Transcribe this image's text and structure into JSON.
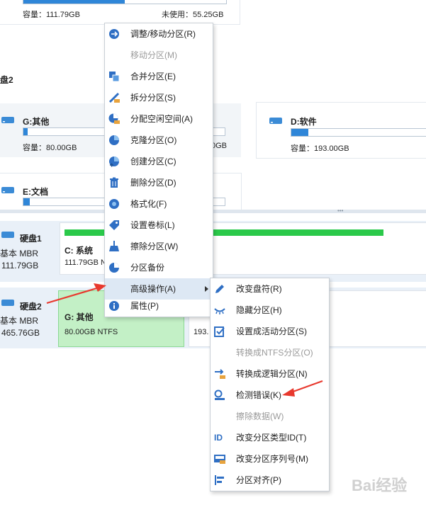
{
  "top_card": {
    "capacity": "容量：111.79GB",
    "unused": "未使用：55.25GB",
    "used_fraction": 0.5
  },
  "section_title": "盘2",
  "cards": {
    "g": {
      "name": "G:其他",
      "capacity": "容量：80.00GB",
      "used_fraction": 0.02,
      "partial_right": "0GB"
    },
    "d": {
      "name": "D:软件",
      "capacity": "容量：193.00GB",
      "used_fraction": 0.12
    },
    "e": {
      "name": "E:文档",
      "used_fraction": 0.03
    }
  },
  "divider_dots": "•••",
  "disks": [
    {
      "name": "硬盘1",
      "type": "基本 MBR",
      "size": "111.79GB",
      "partition_label": "C: 系统",
      "partition_size": "111.79GB NTFS",
      "used_fraction": 0.52
    },
    {
      "name": "硬盘2",
      "type": "基本 MBR",
      "size": "465.76GB",
      "partition_label": "G: 其他",
      "partition_size": "80.00GB NTFS",
      "next_size": "193."
    }
  ],
  "context_menu": [
    {
      "label": "调整/移动分区(R)",
      "icon": "resize-icon",
      "enabled": true
    },
    {
      "label": "移动分区(M)",
      "icon": "",
      "enabled": false
    },
    {
      "label": "合并分区(E)",
      "icon": "merge-icon",
      "enabled": true
    },
    {
      "label": "拆分分区(S)",
      "icon": "split-icon",
      "enabled": true
    },
    {
      "label": "分配空闲空间(A)",
      "icon": "allocate-icon",
      "enabled": true
    },
    {
      "label": "克隆分区(O)",
      "icon": "clone-icon",
      "enabled": true
    },
    {
      "label": "创建分区(C)",
      "icon": "create-icon",
      "enabled": true
    },
    {
      "label": "删除分区(D)",
      "icon": "trash-icon",
      "enabled": true
    },
    {
      "label": "格式化(F)",
      "icon": "format-icon",
      "enabled": true
    },
    {
      "label": "设置卷标(L)",
      "icon": "tag-icon",
      "enabled": true
    },
    {
      "label": "擦除分区(W)",
      "icon": "wipe-icon",
      "enabled": true
    },
    {
      "label": "分区备份",
      "icon": "backup-icon",
      "enabled": true
    },
    {
      "label": "高级操作(A)",
      "icon": "",
      "enabled": true,
      "highlighted": true
    },
    {
      "label": "属性(P)",
      "icon": "info-icon",
      "enabled": true
    }
  ],
  "submenu": [
    {
      "label": "改变盘符(R)",
      "icon": "pencil-icon",
      "enabled": true
    },
    {
      "label": "隐藏分区(H)",
      "icon": "hide-icon",
      "enabled": true
    },
    {
      "label": "设置成活动分区(S)",
      "icon": "active-icon",
      "enabled": true
    },
    {
      "label": "转换成NTFS分区(O)",
      "icon": "",
      "enabled": false
    },
    {
      "label": "转换成逻辑分区(N)",
      "icon": "convert-icon",
      "enabled": true
    },
    {
      "label": "检测错误(K)",
      "icon": "check-icon",
      "enabled": true
    },
    {
      "label": "擦除数据(W)",
      "icon": "",
      "enabled": false
    },
    {
      "label": "改变分区类型ID(T)",
      "icon": "id-icon",
      "enabled": true
    },
    {
      "label": "改变分区序列号(M)",
      "icon": "serial-icon",
      "enabled": true
    },
    {
      "label": "分区对齐(P)",
      "icon": "align-icon",
      "enabled": true
    }
  ],
  "watermark": "Bai经验",
  "colors": {
    "accent": "#2f86d8",
    "used_green": "#2bc94a",
    "selected_bg": "#c3f0c6",
    "arrow_red": "#e8392e"
  }
}
